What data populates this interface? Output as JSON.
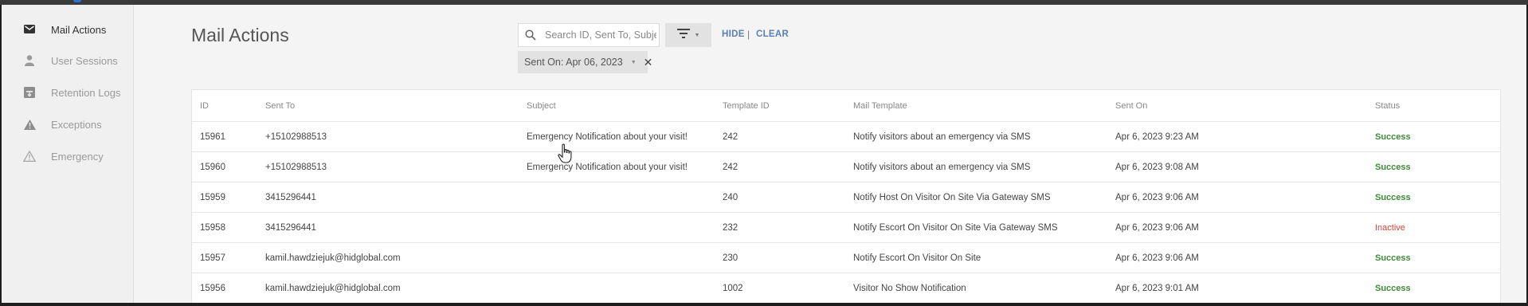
{
  "sidebar": {
    "items": [
      {
        "label": "Mail Actions",
        "icon": "mail-icon",
        "active": true
      },
      {
        "label": "User Sessions",
        "icon": "person-icon",
        "active": false
      },
      {
        "label": "Retention Logs",
        "icon": "archive-icon",
        "active": false
      },
      {
        "label": "Exceptions",
        "icon": "warning-filled-icon",
        "active": false
      },
      {
        "label": "Emergency",
        "icon": "warning-outline-icon",
        "active": false
      }
    ]
  },
  "header": {
    "title": "Mail Actions",
    "search_placeholder": "Search ID, Sent To, Subject",
    "filter_icon": "filter-icon",
    "hide_label": "HIDE",
    "separator": "|",
    "clear_label": "CLEAR"
  },
  "filter_chip": {
    "label": "Sent On: Apr 06, 2023",
    "close": "✕"
  },
  "table": {
    "columns": [
      "ID",
      "Sent To",
      "Subject",
      "Template ID",
      "Mail Template",
      "Sent On",
      "Status"
    ],
    "rows": [
      {
        "id": "15961",
        "sent_to": "+15102988513",
        "subject": "Emergency Notification about your visit!",
        "template_id": "242",
        "mail_template": "Notify visitors about an emergency via SMS",
        "sent_on": "Apr 6, 2023 9:23 AM",
        "status": "Success"
      },
      {
        "id": "15960",
        "sent_to": "+15102988513",
        "subject": "Emergency Notification about your visit!",
        "template_id": "242",
        "mail_template": "Notify visitors about an emergency via SMS",
        "sent_on": "Apr 6, 2023 9:08 AM",
        "status": "Success"
      },
      {
        "id": "15959",
        "sent_to": "3415296441",
        "subject": "",
        "template_id": "240",
        "mail_template": "Notify Host On Visitor On Site Via Gateway SMS",
        "sent_on": "Apr 6, 2023 9:06 AM",
        "status": "Success"
      },
      {
        "id": "15958",
        "sent_to": "3415296441",
        "subject": "",
        "template_id": "232",
        "mail_template": "Notify Escort On Visitor On Site Via Gateway SMS",
        "sent_on": "Apr 6, 2023 9:06 AM",
        "status": "Inactive"
      },
      {
        "id": "15957",
        "sent_to": "kamil.hawdziejuk@hidglobal.com",
        "subject": "",
        "template_id": "230",
        "mail_template": "Notify Escort On Visitor On Site",
        "sent_on": "Apr 6, 2023 9:06 AM",
        "status": "Success"
      },
      {
        "id": "15956",
        "sent_to": "kamil.hawdziejuk@hidglobal.com",
        "subject": "",
        "template_id": "1002",
        "mail_template": "Visitor No Show Notification",
        "sent_on": "Apr 6, 2023 9:01 AM",
        "status": "Success"
      }
    ]
  },
  "colors": {
    "success": "#3d8b37",
    "inactive": "#d9453b",
    "link": "#5a7fb5"
  }
}
